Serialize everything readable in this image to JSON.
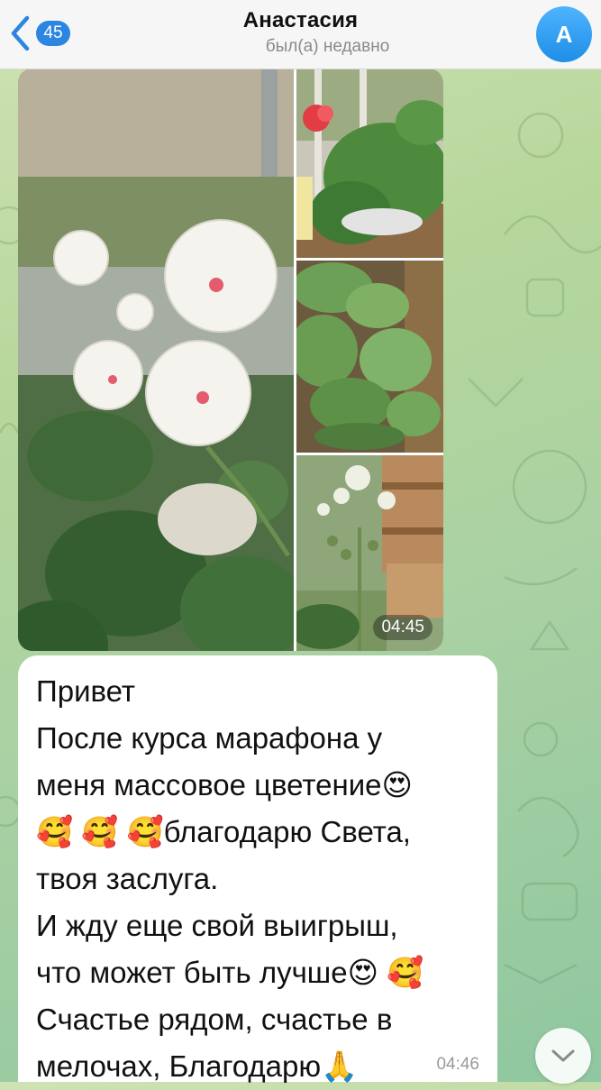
{
  "header": {
    "back_badge": "45",
    "chat_name": "Анастасия",
    "status": "был(а) недавно",
    "avatar_letter": "А"
  },
  "album": {
    "time": "04:45",
    "photos": [
      "white-pelargonium-flowers",
      "red-geranium-on-windowsill",
      "geranium-leaves",
      "geranium-buds"
    ]
  },
  "message": {
    "lines": [
      "Привет",
      "После курса марафона у",
      "меня массовое цветение😍",
      "🥰 🥰 🥰благодарю Света,",
      "твоя заслуга.",
      "И жду еще свой выигрыш,",
      "что может быть лучше😍 🥰",
      "Счастье рядом, счастье в",
      "мелочах, Благодарю🙏"
    ],
    "time": "04:46"
  },
  "colors": {
    "accent": "#2a86e0",
    "bubble": "#ffffff",
    "header": "#f6f6f6"
  }
}
